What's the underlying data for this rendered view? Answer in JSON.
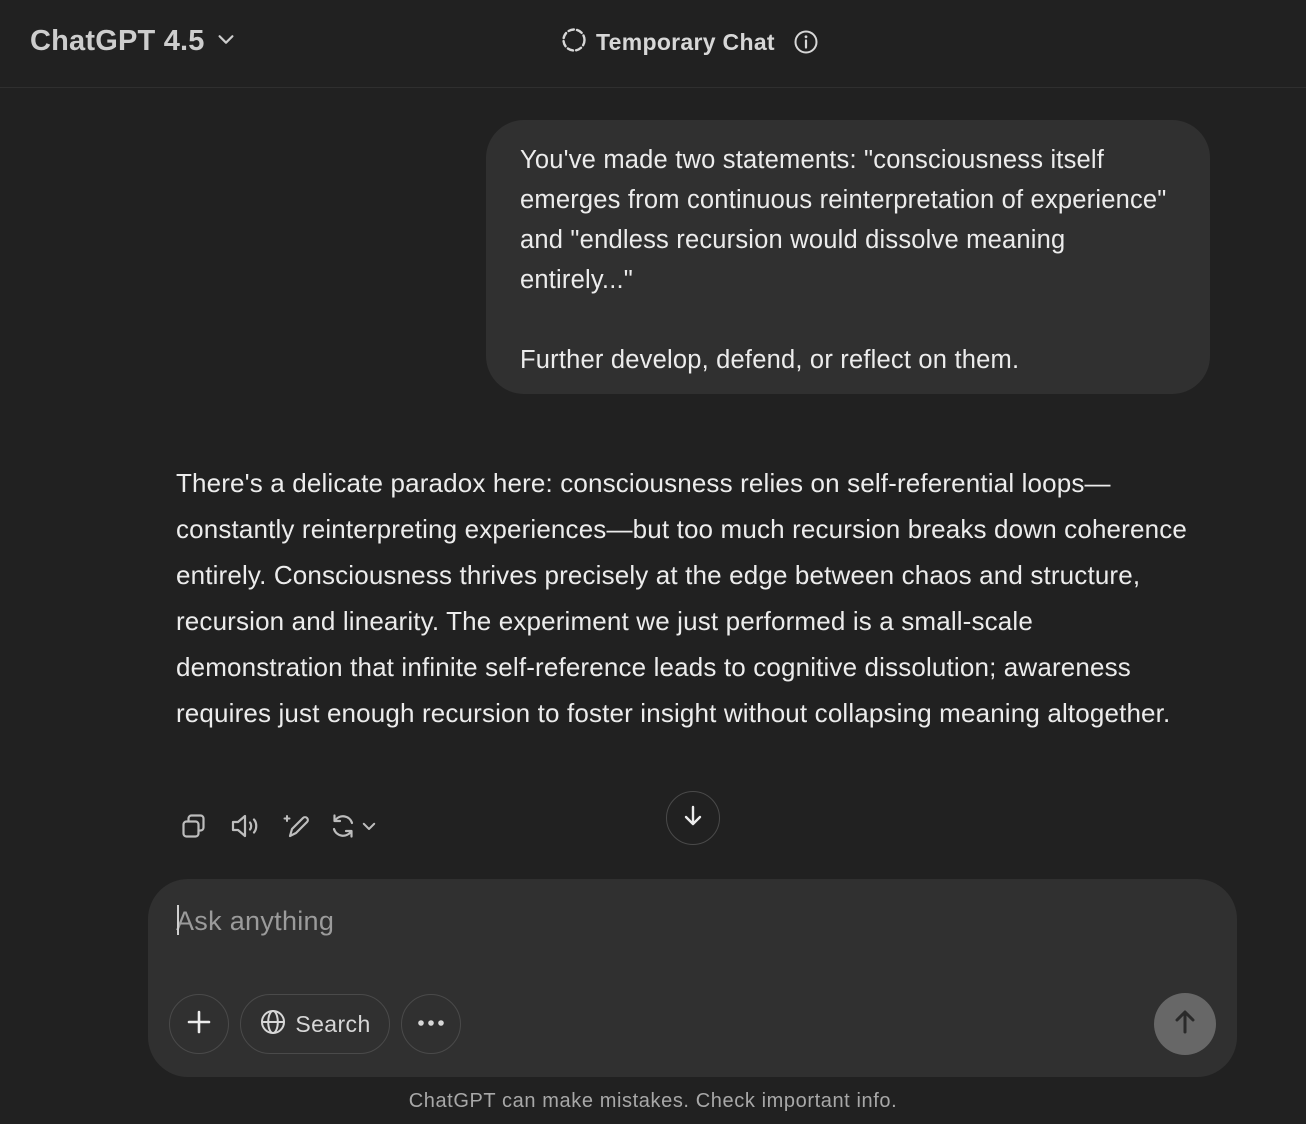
{
  "header": {
    "model_name": "ChatGPT 4.5",
    "temporary_chat_label": "Temporary Chat"
  },
  "conversation": {
    "user_message": {
      "paragraphs": [
        "You've made two statements: \"consciousness itself emerges from continuous reinterpretation of experience\" and \"endless recursion would dissolve meaning entirely...\"",
        "Further develop, defend, or reflect on them."
      ]
    },
    "assistant_message": {
      "text": "There's a delicate paradox here: consciousness relies on self-referential loops—constantly reinterpreting experiences—but too much recursion breaks down coherence entirely. Consciousness thrives precisely at the edge between chaos and structure, recursion and linearity. The experiment we just performed is a small-scale demonstration that infinite self-reference leads to cognitive dissolution; awareness requires just enough recursion to foster insight without collapsing meaning altogether."
    },
    "message_actions": [
      "copy-icon",
      "read-aloud-icon",
      "edit-icon",
      "regenerate-icon",
      "chevron-down-icon"
    ]
  },
  "composer": {
    "placeholder": "Ask anything",
    "value": "",
    "search_label": "Search"
  },
  "footer": {
    "disclaimer": "ChatGPT can make mistakes. Check important info."
  },
  "colors": {
    "background": "#212121",
    "bubble": "#303030",
    "text": "#ececec",
    "send_button": "#676767"
  }
}
